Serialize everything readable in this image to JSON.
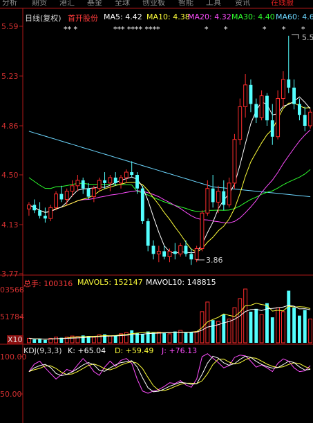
{
  "menu": {
    "items": [
      "分析",
      "期货",
      "港汇",
      "基金",
      "全球",
      "创业板",
      "智能",
      "工具",
      "资讯"
    ],
    "right_item": "在线服"
  },
  "header": {
    "title": "日线(复权)",
    "stock": "首开股份",
    "ma5": "MA5: 4.42",
    "ma10": "MA10: 4.38",
    "ma20": "MA20: 4.32",
    "ma30": "MA30: 4.40",
    "ma60": "MA60: 4.6"
  },
  "stars": {
    "group1": "** *",
    "group2": "*** **** ****",
    "group3": "*",
    "group4": "*",
    "group5": "*",
    "group6": "*",
    "group7": "*"
  },
  "price_axis": [
    "5.59",
    "5.23",
    "4.86",
    "4.50",
    "4.13",
    "3.77"
  ],
  "annotations": {
    "high": "5.5",
    "low": "3.86"
  },
  "volume_header": {
    "label": "总手: 100316",
    "mavol5": "MAVOL5: 152147",
    "mavol10": "MAVOL10: 148815"
  },
  "volume_axis": {
    "top": "03568",
    "mid": "51784",
    "unit": "X10"
  },
  "kdj_header": {
    "label": "KDJ(9,3,3)",
    "k": "K: +65.04",
    "d": "D: +59.49",
    "j": "J: +76.13"
  },
  "kdj_axis": {
    "top": "100.00",
    "mid": "50.00"
  },
  "colors": {
    "up": "#ff2d2d",
    "down": "#54ffff",
    "ma5": "#ffffff",
    "ma10": "#ffff3a",
    "ma20": "#ff4dff",
    "ma30": "#2eff2e",
    "ma60": "#6cd7ff",
    "axis": "#b01818"
  },
  "chart_data": {
    "type": "candlestick",
    "price_range": [
      3.77,
      5.59
    ],
    "candles_ohlc": [
      [
        4.25,
        4.3,
        4.2,
        4.28
      ],
      [
        4.28,
        4.32,
        4.22,
        4.24
      ],
      [
        4.24,
        4.3,
        4.18,
        4.2
      ],
      [
        4.2,
        4.26,
        4.15,
        4.18
      ],
      [
        4.18,
        4.28,
        4.16,
        4.26
      ],
      [
        4.26,
        4.38,
        4.24,
        4.36
      ],
      [
        4.36,
        4.42,
        4.3,
        4.32
      ],
      [
        4.32,
        4.4,
        4.28,
        4.38
      ],
      [
        4.38,
        4.46,
        4.34,
        4.42
      ],
      [
        4.42,
        4.5,
        4.38,
        4.46
      ],
      [
        4.46,
        4.48,
        4.36,
        4.4
      ],
      [
        4.4,
        4.44,
        4.32,
        4.34
      ],
      [
        4.34,
        4.42,
        4.3,
        4.4
      ],
      [
        4.4,
        4.48,
        4.38,
        4.46
      ],
      [
        4.46,
        4.52,
        4.4,
        4.44
      ],
      [
        4.44,
        4.5,
        4.38,
        4.48
      ],
      [
        4.48,
        4.52,
        4.42,
        4.44
      ],
      [
        4.44,
        4.5,
        4.4,
        4.48
      ],
      [
        4.48,
        4.54,
        4.44,
        4.52
      ],
      [
        4.52,
        4.6,
        4.48,
        4.5
      ],
      [
        4.5,
        4.52,
        4.36,
        4.4
      ],
      [
        4.4,
        4.42,
        4.14,
        4.16
      ],
      [
        4.16,
        4.18,
        3.94,
        3.98
      ],
      [
        3.98,
        4.02,
        3.88,
        3.92
      ],
      [
        3.92,
        3.98,
        3.86,
        3.94
      ],
      [
        3.94,
        3.98,
        3.88,
        3.9
      ],
      [
        3.9,
        3.96,
        3.86,
        3.94
      ],
      [
        3.94,
        4.0,
        3.88,
        3.92
      ],
      [
        3.92,
        4.0,
        3.9,
        3.98
      ],
      [
        3.98,
        4.02,
        3.9,
        3.92
      ],
      [
        3.92,
        3.96,
        3.84,
        3.88
      ],
      [
        3.88,
        3.98,
        3.86,
        3.96
      ],
      [
        3.96,
        4.24,
        3.94,
        4.22
      ],
      [
        4.22,
        4.46,
        4.2,
        4.4
      ],
      [
        4.4,
        4.5,
        4.26,
        4.3
      ],
      [
        4.3,
        4.42,
        4.22,
        4.38
      ],
      [
        4.38,
        4.46,
        4.24,
        4.28
      ],
      [
        4.28,
        4.48,
        4.26,
        4.44
      ],
      [
        4.44,
        4.8,
        4.4,
        4.76
      ],
      [
        4.76,
        5.06,
        4.72,
        5.0
      ],
      [
        5.0,
        5.24,
        4.92,
        5.16
      ],
      [
        5.16,
        5.2,
        4.96,
        5.02
      ],
      [
        5.02,
        5.06,
        4.88,
        4.92
      ],
      [
        4.92,
        5.12,
        4.9,
        5.08
      ],
      [
        5.08,
        5.1,
        4.86,
        4.9
      ],
      [
        4.9,
        5.02,
        4.72,
        4.78
      ],
      [
        4.78,
        5.12,
        4.76,
        5.06
      ],
      [
        5.06,
        5.26,
        5.0,
        5.2
      ],
      [
        5.2,
        5.52,
        5.1,
        5.14
      ],
      [
        5.14,
        5.2,
        4.98,
        5.02
      ],
      [
        5.02,
        5.06,
        4.9,
        4.94
      ],
      [
        4.94,
        5.0,
        4.82,
        4.86
      ],
      [
        4.86,
        4.98,
        4.84,
        4.96
      ]
    ]
  }
}
